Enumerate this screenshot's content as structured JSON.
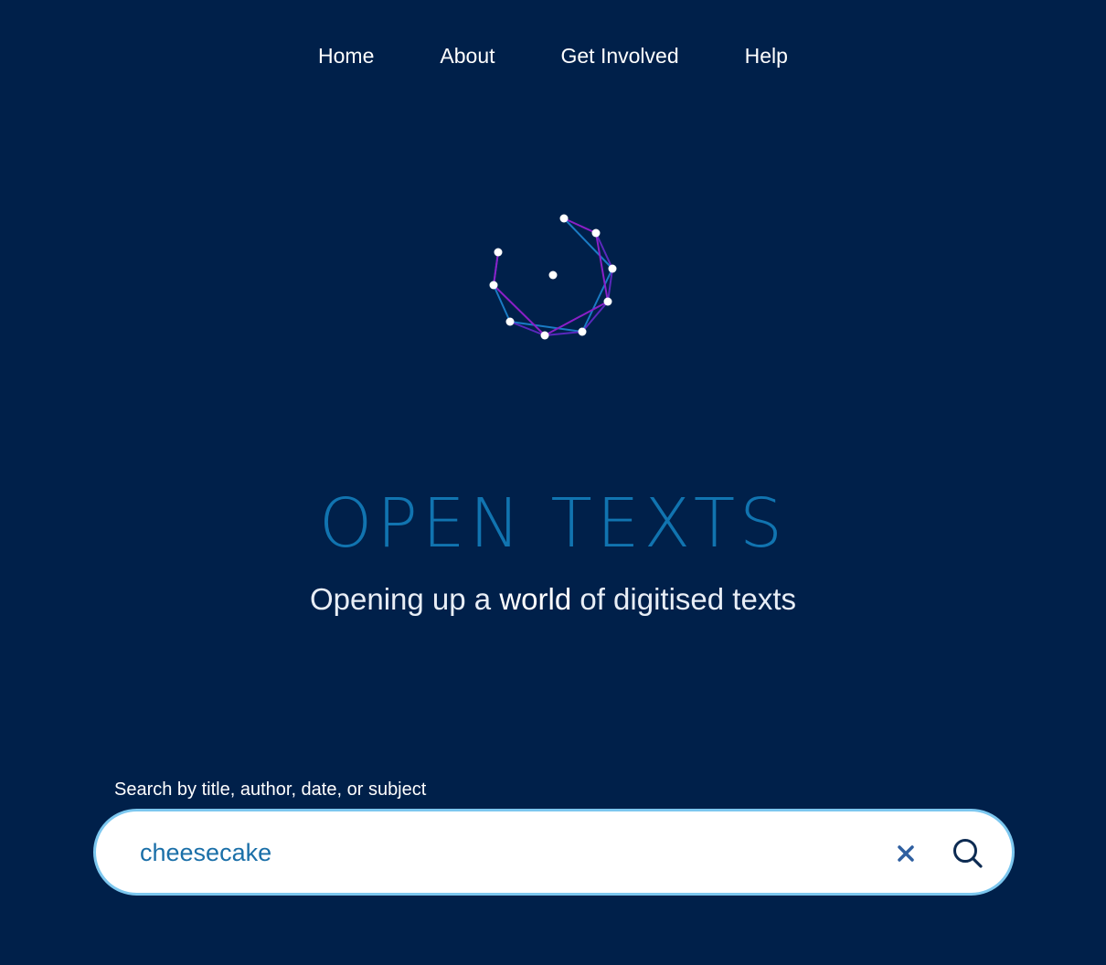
{
  "nav": {
    "items": [
      {
        "label": "Home"
      },
      {
        "label": "About"
      },
      {
        "label": "Get Involved"
      },
      {
        "label": "Help"
      }
    ]
  },
  "hero": {
    "title": "OPEN TEXTS",
    "tagline_before": "Opening up a ",
    "tagline_emphasis": "world",
    "tagline_after": " of digitised texts"
  },
  "search": {
    "label": "Search by title, author, date, or subject",
    "value": "cheesecake",
    "clear_icon": "close-icon",
    "submit_icon": "search-icon"
  },
  "colors": {
    "background": "#00204a",
    "brand": "#1174b0",
    "search_border": "#7cc7ef",
    "input_text": "#1a6fa8",
    "logo_blue": "#1a7bc4",
    "logo_purple": "#8b1fc7"
  }
}
